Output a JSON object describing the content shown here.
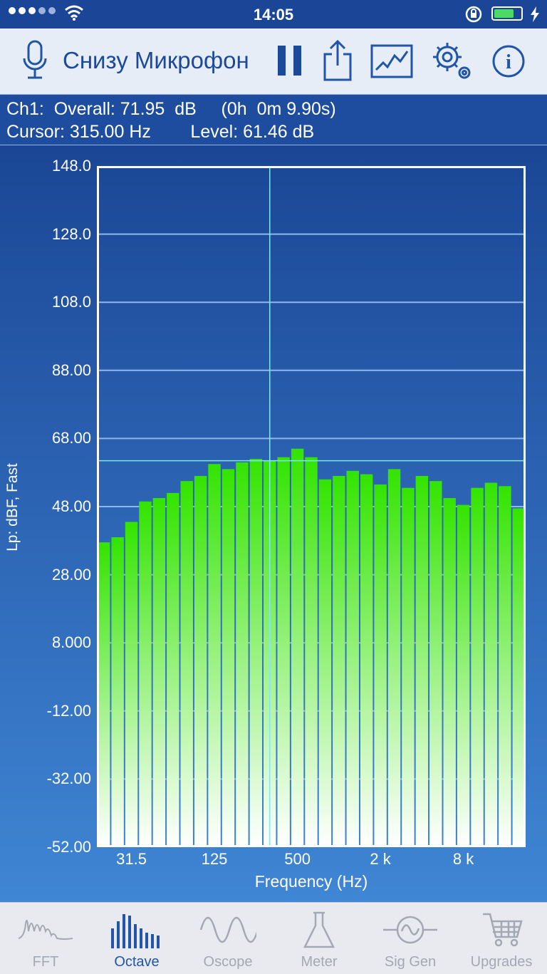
{
  "status_bar": {
    "time": "14:05",
    "signal_bars": 5,
    "signal_filled": 3,
    "battery_level": 0.75
  },
  "toolbar": {
    "title": "Снизу Микрофон",
    "icons": [
      "microphone-icon",
      "pause-icon",
      "share-icon",
      "waveform-view-icon",
      "settings-icon",
      "info-icon"
    ]
  },
  "info": {
    "line1": "Ch1:  Overall: 71.95  dB     (0h  0m 9.90s)",
    "line2": "Cursor: 315.00 Hz        Level: 61.46 dB"
  },
  "colors": {
    "bar_top": "#33e400",
    "bar_bottom": "#ffffff",
    "grid": "#8fb8ea",
    "cursor": "#7fe6ff",
    "accent": "#2055a8"
  },
  "chart_data": {
    "type": "bar",
    "ylabel": "Lp: dBF, Fast",
    "xlabel": "Frequency (Hz)",
    "ylim": [
      -52,
      148
    ],
    "y_ticks": [
      "148.0",
      "128.0",
      "108.0",
      "88.00",
      "68.00",
      "48.00",
      "28.00",
      "8.000",
      "-12.00",
      "-32.00",
      "-52.00"
    ],
    "x_ticks": [
      "31.5",
      "125",
      "500",
      "2 k",
      "8 k"
    ],
    "x_tick_band_index": [
      2,
      8,
      14,
      20,
      26
    ],
    "values": [
      37.5,
      39,
      43.5,
      49.5,
      50.5,
      52,
      55.5,
      57,
      60.5,
      59,
      61,
      62,
      61.5,
      62.5,
      65,
      62.5,
      56,
      57,
      58.5,
      57.5,
      54.5,
      59,
      53.5,
      57,
      55.5,
      50.5,
      48.5,
      53.5,
      55,
      54,
      47.5
    ],
    "cursor_band_index": 12,
    "cursor_level": 61.46,
    "grid": true
  },
  "tabs": [
    {
      "label": "FFT",
      "icon": "fft-icon",
      "active": false
    },
    {
      "label": "Octave",
      "icon": "octave-icon",
      "active": true
    },
    {
      "label": "Oscope",
      "icon": "oscope-icon",
      "active": false
    },
    {
      "label": "Meter",
      "icon": "meter-flask-icon",
      "active": false
    },
    {
      "label": "Sig Gen",
      "icon": "sig-gen-icon",
      "active": false
    },
    {
      "label": "Upgrades",
      "icon": "shopping-cart-icon",
      "active": false
    }
  ]
}
